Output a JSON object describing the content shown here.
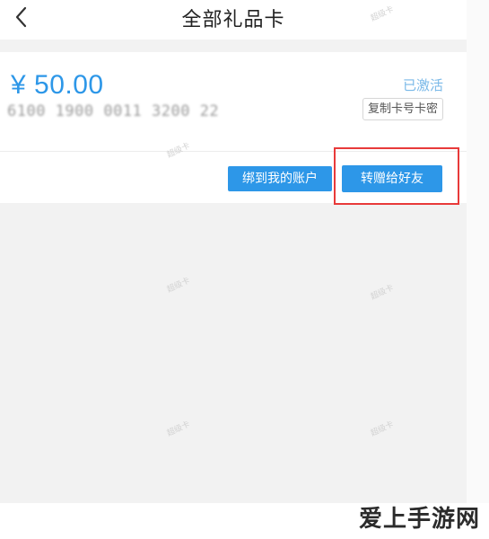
{
  "header": {
    "title": "全部礼品卡"
  },
  "card": {
    "amount": "¥ 50.00",
    "number": "6100 1900 0011 3200 22",
    "status": "已激活",
    "copy_label": "复制卡号卡密"
  },
  "actions": {
    "bind_label": "绑到我的账户",
    "gift_label": "转赠给好友"
  },
  "colors": {
    "accent": "#2d97e8",
    "status": "#7ab9e8",
    "highlight": "#e83a3a"
  },
  "watermarks": {
    "faint": "超级卡",
    "site": "爱上手游网"
  }
}
